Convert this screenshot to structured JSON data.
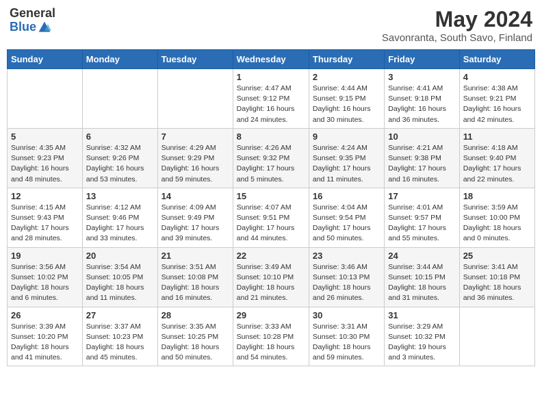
{
  "header": {
    "logo_general": "General",
    "logo_blue": "Blue",
    "main_title": "May 2024",
    "subtitle": "Savonranta, South Savo, Finland"
  },
  "days_of_week": [
    "Sunday",
    "Monday",
    "Tuesday",
    "Wednesday",
    "Thursday",
    "Friday",
    "Saturday"
  ],
  "weeks": [
    [
      {
        "day": "",
        "info": ""
      },
      {
        "day": "",
        "info": ""
      },
      {
        "day": "",
        "info": ""
      },
      {
        "day": "1",
        "info": "Sunrise: 4:47 AM\nSunset: 9:12 PM\nDaylight: 16 hours\nand 24 minutes."
      },
      {
        "day": "2",
        "info": "Sunrise: 4:44 AM\nSunset: 9:15 PM\nDaylight: 16 hours\nand 30 minutes."
      },
      {
        "day": "3",
        "info": "Sunrise: 4:41 AM\nSunset: 9:18 PM\nDaylight: 16 hours\nand 36 minutes."
      },
      {
        "day": "4",
        "info": "Sunrise: 4:38 AM\nSunset: 9:21 PM\nDaylight: 16 hours\nand 42 minutes."
      }
    ],
    [
      {
        "day": "5",
        "info": "Sunrise: 4:35 AM\nSunset: 9:23 PM\nDaylight: 16 hours\nand 48 minutes."
      },
      {
        "day": "6",
        "info": "Sunrise: 4:32 AM\nSunset: 9:26 PM\nDaylight: 16 hours\nand 53 minutes."
      },
      {
        "day": "7",
        "info": "Sunrise: 4:29 AM\nSunset: 9:29 PM\nDaylight: 16 hours\nand 59 minutes."
      },
      {
        "day": "8",
        "info": "Sunrise: 4:26 AM\nSunset: 9:32 PM\nDaylight: 17 hours\nand 5 minutes."
      },
      {
        "day": "9",
        "info": "Sunrise: 4:24 AM\nSunset: 9:35 PM\nDaylight: 17 hours\nand 11 minutes."
      },
      {
        "day": "10",
        "info": "Sunrise: 4:21 AM\nSunset: 9:38 PM\nDaylight: 17 hours\nand 16 minutes."
      },
      {
        "day": "11",
        "info": "Sunrise: 4:18 AM\nSunset: 9:40 PM\nDaylight: 17 hours\nand 22 minutes."
      }
    ],
    [
      {
        "day": "12",
        "info": "Sunrise: 4:15 AM\nSunset: 9:43 PM\nDaylight: 17 hours\nand 28 minutes."
      },
      {
        "day": "13",
        "info": "Sunrise: 4:12 AM\nSunset: 9:46 PM\nDaylight: 17 hours\nand 33 minutes."
      },
      {
        "day": "14",
        "info": "Sunrise: 4:09 AM\nSunset: 9:49 PM\nDaylight: 17 hours\nand 39 minutes."
      },
      {
        "day": "15",
        "info": "Sunrise: 4:07 AM\nSunset: 9:51 PM\nDaylight: 17 hours\nand 44 minutes."
      },
      {
        "day": "16",
        "info": "Sunrise: 4:04 AM\nSunset: 9:54 PM\nDaylight: 17 hours\nand 50 minutes."
      },
      {
        "day": "17",
        "info": "Sunrise: 4:01 AM\nSunset: 9:57 PM\nDaylight: 17 hours\nand 55 minutes."
      },
      {
        "day": "18",
        "info": "Sunrise: 3:59 AM\nSunset: 10:00 PM\nDaylight: 18 hours\nand 0 minutes."
      }
    ],
    [
      {
        "day": "19",
        "info": "Sunrise: 3:56 AM\nSunset: 10:02 PM\nDaylight: 18 hours\nand 6 minutes."
      },
      {
        "day": "20",
        "info": "Sunrise: 3:54 AM\nSunset: 10:05 PM\nDaylight: 18 hours\nand 11 minutes."
      },
      {
        "day": "21",
        "info": "Sunrise: 3:51 AM\nSunset: 10:08 PM\nDaylight: 18 hours\nand 16 minutes."
      },
      {
        "day": "22",
        "info": "Sunrise: 3:49 AM\nSunset: 10:10 PM\nDaylight: 18 hours\nand 21 minutes."
      },
      {
        "day": "23",
        "info": "Sunrise: 3:46 AM\nSunset: 10:13 PM\nDaylight: 18 hours\nand 26 minutes."
      },
      {
        "day": "24",
        "info": "Sunrise: 3:44 AM\nSunset: 10:15 PM\nDaylight: 18 hours\nand 31 minutes."
      },
      {
        "day": "25",
        "info": "Sunrise: 3:41 AM\nSunset: 10:18 PM\nDaylight: 18 hours\nand 36 minutes."
      }
    ],
    [
      {
        "day": "26",
        "info": "Sunrise: 3:39 AM\nSunset: 10:20 PM\nDaylight: 18 hours\nand 41 minutes."
      },
      {
        "day": "27",
        "info": "Sunrise: 3:37 AM\nSunset: 10:23 PM\nDaylight: 18 hours\nand 45 minutes."
      },
      {
        "day": "28",
        "info": "Sunrise: 3:35 AM\nSunset: 10:25 PM\nDaylight: 18 hours\nand 50 minutes."
      },
      {
        "day": "29",
        "info": "Sunrise: 3:33 AM\nSunset: 10:28 PM\nDaylight: 18 hours\nand 54 minutes."
      },
      {
        "day": "30",
        "info": "Sunrise: 3:31 AM\nSunset: 10:30 PM\nDaylight: 18 hours\nand 59 minutes."
      },
      {
        "day": "31",
        "info": "Sunrise: 3:29 AM\nSunset: 10:32 PM\nDaylight: 19 hours\nand 3 minutes."
      },
      {
        "day": "",
        "info": ""
      }
    ]
  ]
}
